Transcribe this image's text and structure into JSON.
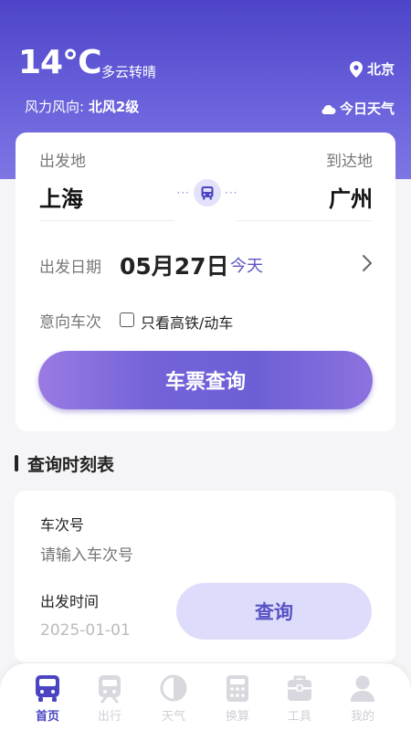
{
  "weather": {
    "temperature": "14°C",
    "description": "多云转晴",
    "location": "北京",
    "wind_label": "风力风向: ",
    "wind_value": "北风2级",
    "today_weather": "今日天气"
  },
  "ticket_form": {
    "from_label": "出发地",
    "to_label": "到达地",
    "from_city": "上海",
    "to_city": "广州",
    "date_label": "出发日期",
    "date_value": "05月27日",
    "date_tag": "今天",
    "train_pref_label": "意向车次",
    "highspeed_only_label": "只看高铁/动车",
    "search_button": "车票查询"
  },
  "timetable": {
    "section_title": "查询时刻表",
    "train_no_label": "车次号",
    "train_no_placeholder": "请输入车次号",
    "depart_time_label": "出发时间",
    "depart_time_value": "2025-01-01",
    "query_button": "查询"
  },
  "tabbar": {
    "items": [
      {
        "label": "首页",
        "icon": "bus-icon",
        "active": true
      },
      {
        "label": "出行",
        "icon": "train-icon",
        "active": false
      },
      {
        "label": "天气",
        "icon": "half-moon-icon",
        "active": false
      },
      {
        "label": "换算",
        "icon": "calculator-icon",
        "active": false
      },
      {
        "label": "工具",
        "icon": "toolbox-icon",
        "active": false
      },
      {
        "label": "我的",
        "icon": "user-icon",
        "active": false
      }
    ]
  },
  "colors": {
    "brand": "#5a55c8",
    "header_gradient_top": "#4d44c8",
    "tab_active": "#4a44c2",
    "tab_inactive": "#cfcfd6"
  }
}
